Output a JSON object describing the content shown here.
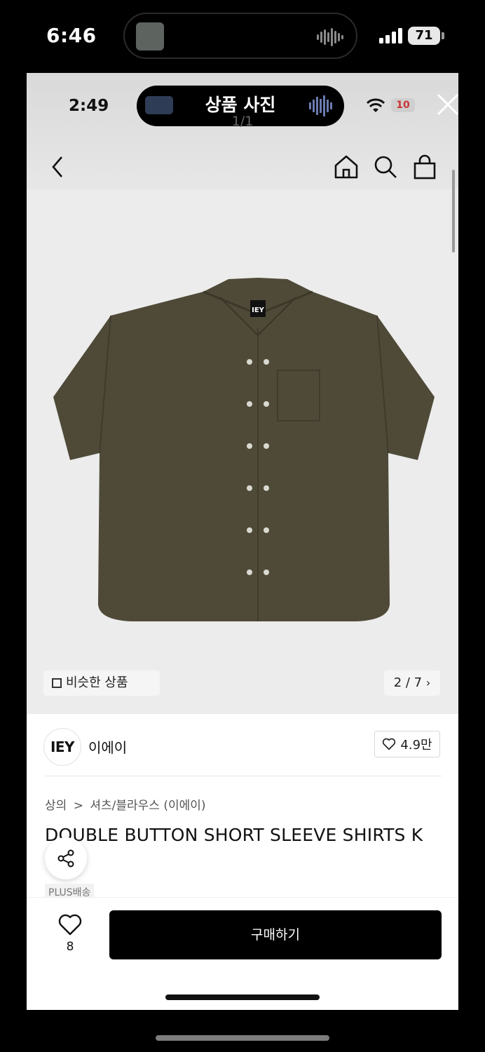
{
  "outer_status": {
    "time": "6:46",
    "battery": "71"
  },
  "inner_status": {
    "time": "2:49",
    "battery": "10"
  },
  "viewer": {
    "title": "상품 사진",
    "counter": "1/1"
  },
  "similar_button": {
    "label": "비슷한 상품"
  },
  "pager": {
    "label": "2 / 7"
  },
  "product_image": {
    "label_text": "IEY",
    "shirt_color": "#4f4a38"
  },
  "brand": {
    "logo_text": "IEY",
    "name": "이에이",
    "likes": "4.9만"
  },
  "breadcrumb": {
    "category": "상의",
    "separator": ">",
    "subcategory": "셔츠/블라우스 (이에이)"
  },
  "product": {
    "title": "DOUBLE BUTTON SHORT SLEEVE SHIRTS K",
    "shipping_badge": "PLUS배송"
  },
  "bottom": {
    "wish_count": "8",
    "buy_label": "구매하기"
  },
  "colors": {
    "buy_button": "#000000",
    "product_bg": "#ececec"
  }
}
